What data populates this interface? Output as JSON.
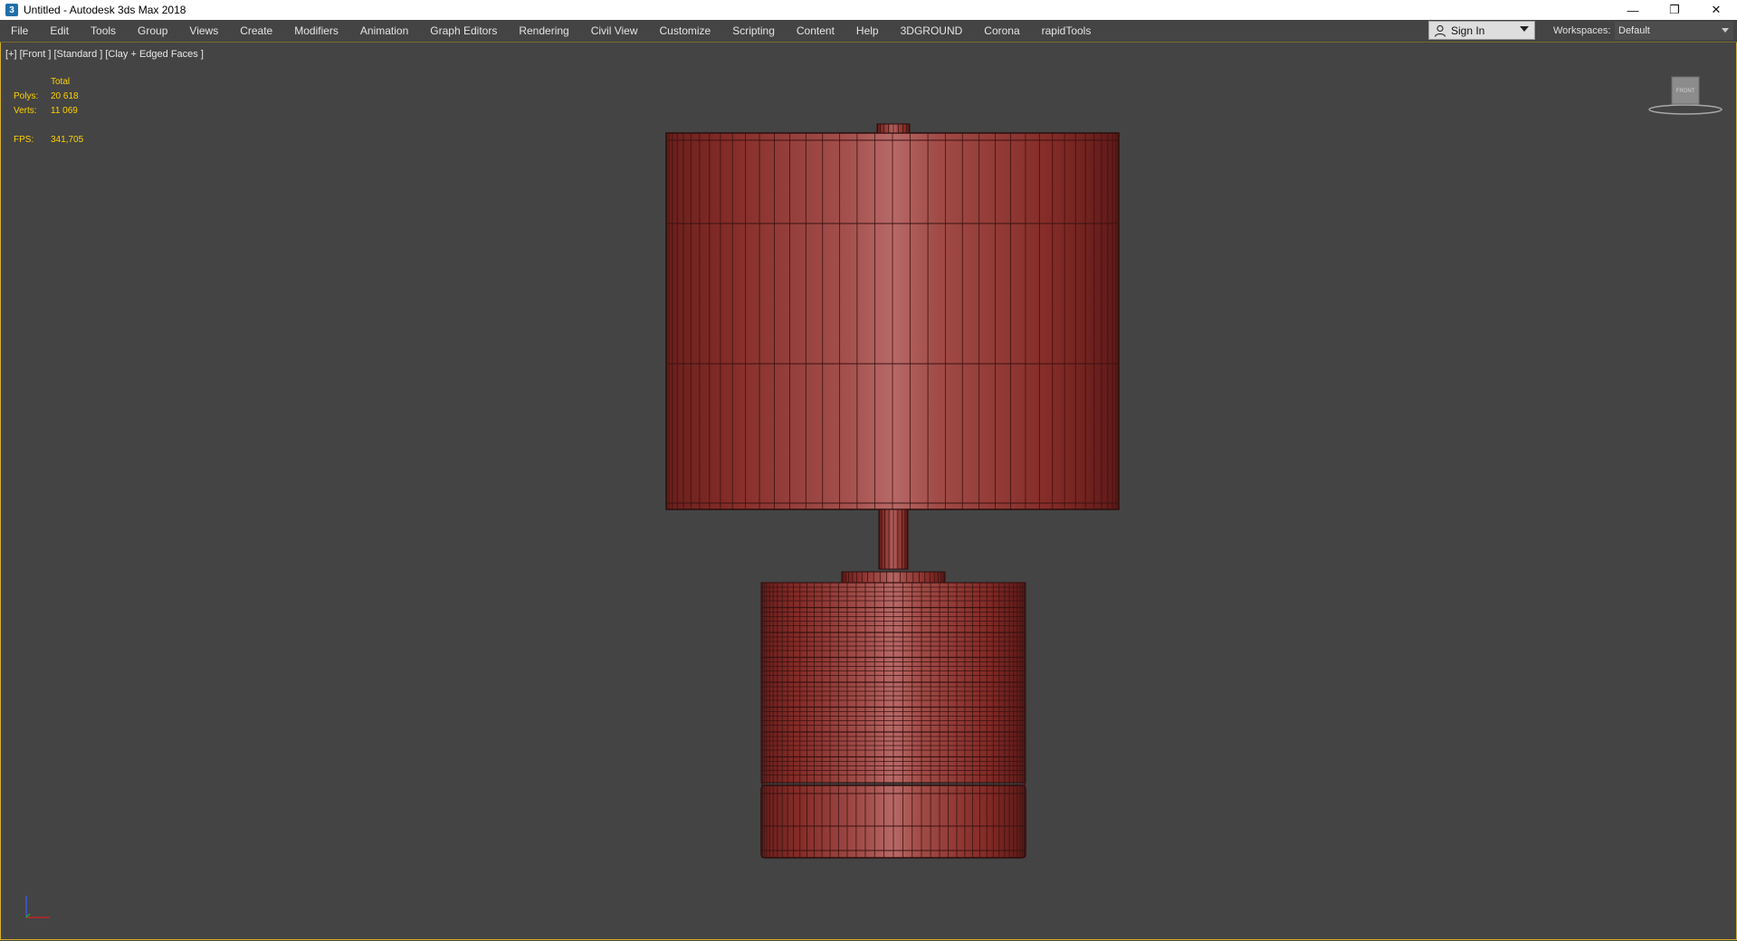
{
  "window": {
    "title": "Untitled - Autodesk 3ds Max 2018",
    "app_icon": "3"
  },
  "menu": [
    "File",
    "Edit",
    "Tools",
    "Group",
    "Views",
    "Create",
    "Modifiers",
    "Animation",
    "Graph Editors",
    "Rendering",
    "Civil View",
    "Customize",
    "Scripting",
    "Content",
    "Help",
    "3DGROUND",
    "Corona",
    "rapidTools"
  ],
  "account": {
    "sign_in": "Sign In"
  },
  "workspaces": {
    "label": "Workspaces:",
    "value": "Default"
  },
  "viewport": {
    "label": "[+] [Front ] [Standard ] [Clay + Edged Faces ]",
    "stats": {
      "header": "Total",
      "polys_label": "Polys:",
      "polys": "20 618",
      "verts_label": "Verts:",
      "verts": "11 069",
      "fps_label": "FPS:",
      "fps": "341,705"
    },
    "viewcube_label": "FRONT"
  },
  "colors": {
    "viewport_bg": "#444444",
    "viewport_border": "#d8b12a",
    "stats_text": "#ffd200",
    "model_base": "#8a2f2b"
  }
}
